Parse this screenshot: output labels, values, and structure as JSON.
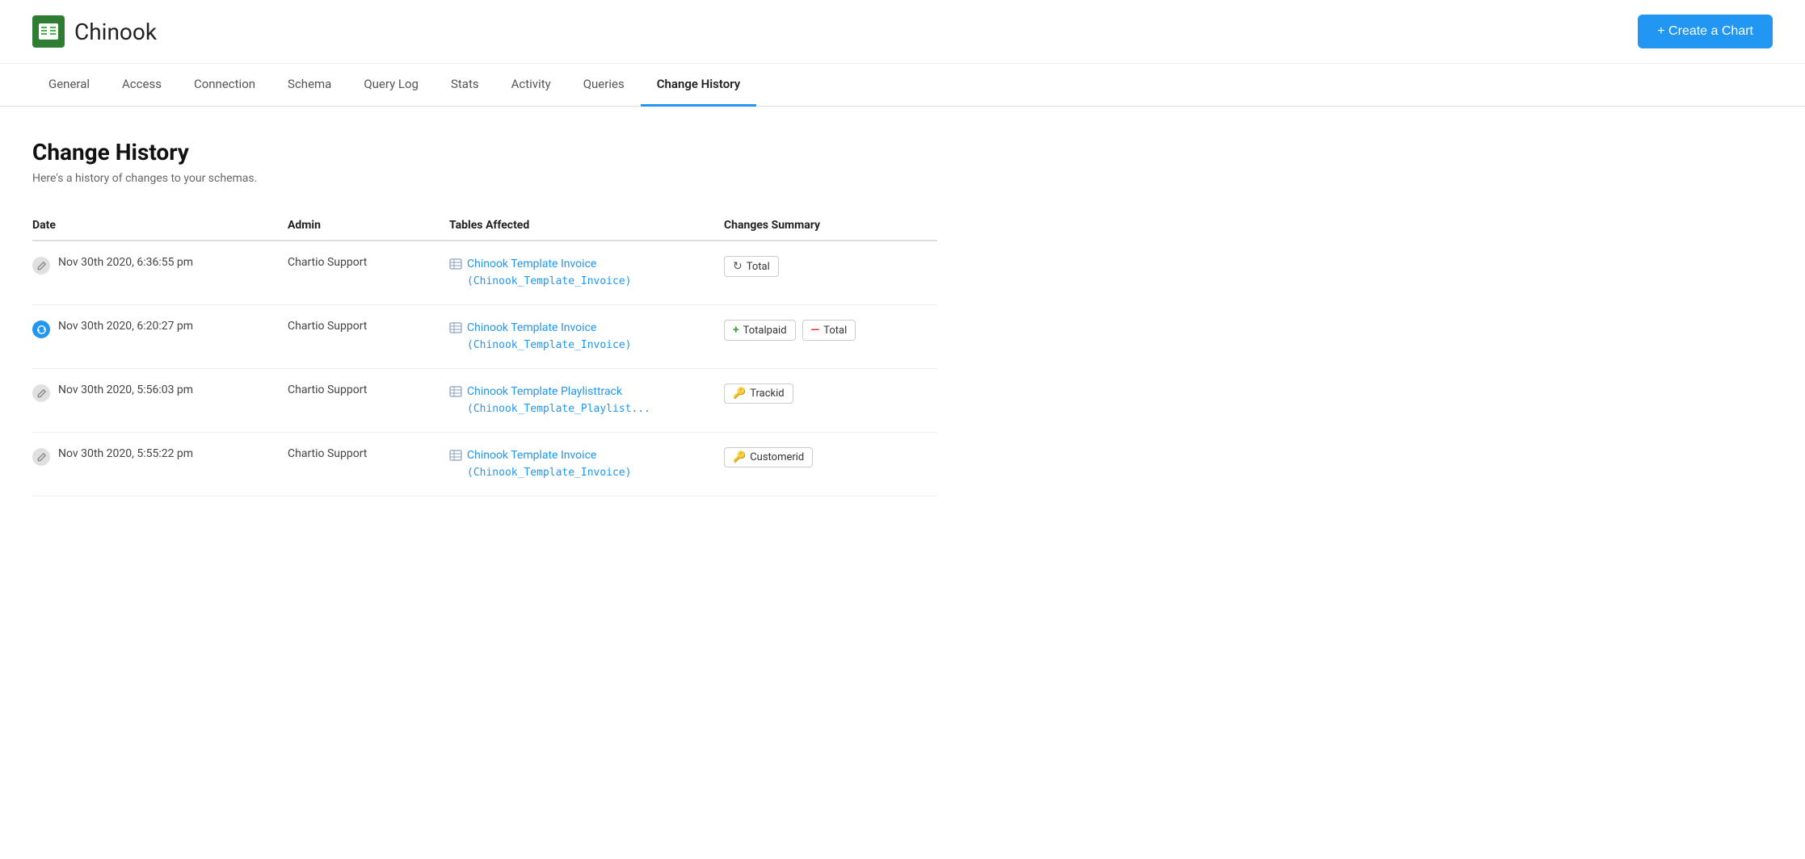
{
  "header": {
    "app_name": "Chinook",
    "create_chart_label": "+ Create a Chart"
  },
  "nav": {
    "tabs": [
      {
        "label": "General",
        "active": false,
        "id": "general"
      },
      {
        "label": "Access",
        "active": false,
        "id": "access"
      },
      {
        "label": "Connection",
        "active": false,
        "id": "connection"
      },
      {
        "label": "Schema",
        "active": false,
        "id": "schema"
      },
      {
        "label": "Query Log",
        "active": false,
        "id": "query-log"
      },
      {
        "label": "Stats",
        "active": false,
        "id": "stats"
      },
      {
        "label": "Activity",
        "active": false,
        "id": "activity"
      },
      {
        "label": "Queries",
        "active": false,
        "id": "queries"
      },
      {
        "label": "Change History",
        "active": true,
        "id": "change-history"
      }
    ]
  },
  "page": {
    "title": "Change History",
    "subtitle": "Here's a history of changes to your schemas.",
    "table": {
      "columns": [
        "Date",
        "Admin",
        "Tables Affected",
        "Changes Summary"
      ],
      "rows": [
        {
          "icon_type": "gray",
          "date": "Nov 30th 2020, 6:36:55 pm",
          "admin": "Chartio Support",
          "table_name": "Chinook Template Invoice",
          "table_code": "(Chinook_Template_Invoice)",
          "changes": [
            {
              "icon": "refresh",
              "label": "Total"
            }
          ]
        },
        {
          "icon_type": "blue",
          "date": "Nov 30th 2020, 6:20:27 pm",
          "admin": "Chartio Support",
          "table_name": "Chinook Template Invoice",
          "table_code": "(Chinook_Template_Invoice)",
          "changes": [
            {
              "icon": "plus",
              "label": "Totalpaid"
            },
            {
              "icon": "minus",
              "label": "Total"
            }
          ]
        },
        {
          "icon_type": "gray",
          "date": "Nov 30th 2020, 5:56:03 pm",
          "admin": "Chartio Support",
          "table_name": "Chinook Template Playlisttrack",
          "table_code": "(Chinook_Template_Playlist...",
          "changes": [
            {
              "icon": "key",
              "label": "Trackid"
            }
          ]
        },
        {
          "icon_type": "gray",
          "date": "Nov 30th 2020, 5:55:22 pm",
          "admin": "Chartio Support",
          "table_name": "Chinook Template Invoice",
          "table_code": "(Chinook_Template_Invoice)",
          "changes": [
            {
              "icon": "key",
              "label": "Customerid"
            }
          ]
        }
      ]
    }
  }
}
